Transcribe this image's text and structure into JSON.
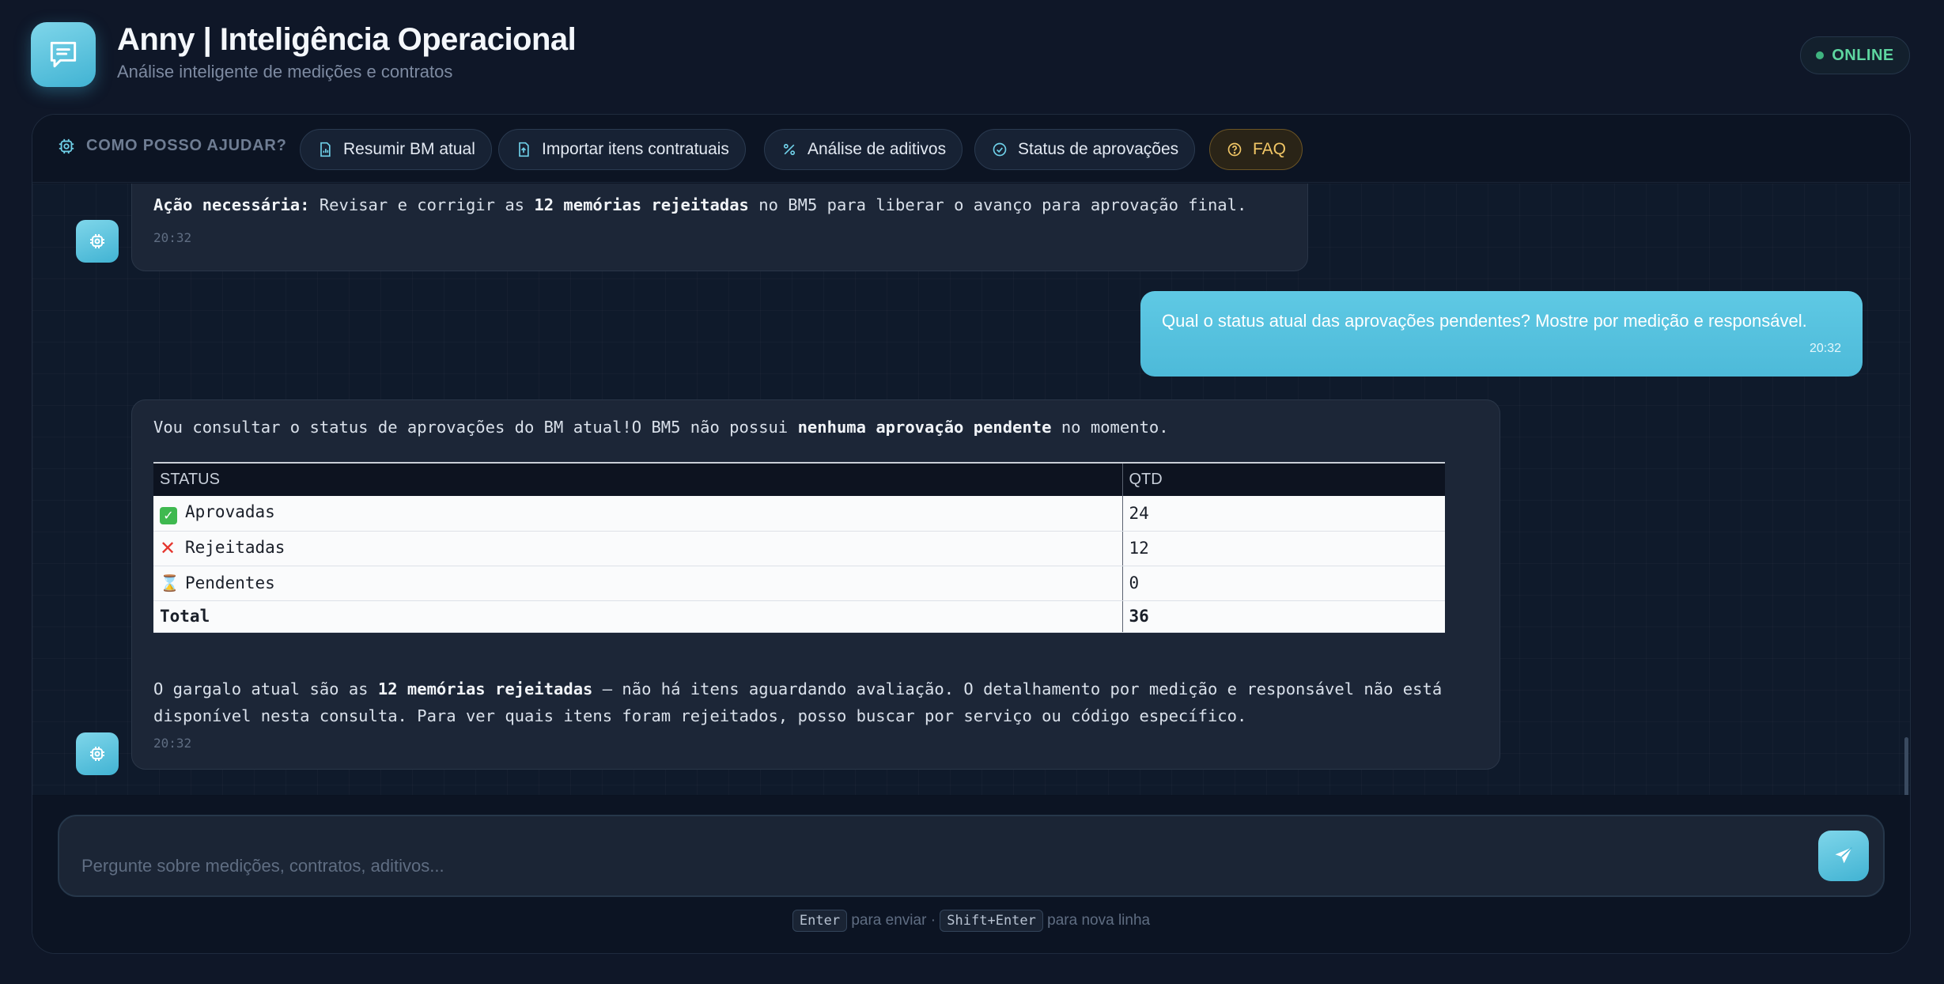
{
  "header": {
    "title": "Anny | Inteligência Operacional",
    "subtitle": "Análise inteligente de medições e contratos",
    "status": "ONLINE",
    "logo_icon": "chat-bubble-icon"
  },
  "toolbar": {
    "help_label": "COMO POSSO AJUDAR?",
    "chips": [
      {
        "label": "Resumir BM atual",
        "icon": "report-icon"
      },
      {
        "label": "Importar itens contratuais",
        "icon": "upload-file-icon"
      },
      {
        "label": "Análise de aditivos",
        "icon": "percent-icon"
      },
      {
        "label": "Status de aprovações",
        "icon": "check-circle-icon"
      },
      {
        "label": "FAQ",
        "icon": "question-circle-icon"
      }
    ]
  },
  "messages": {
    "m1": {
      "bold_prefix": "Ação necessária:",
      "text_a": " Revisar e corrigir as ",
      "bold_mid": "12 memórias rejeitadas",
      "text_b": " no BM5 para liberar o avanço para aprovação final.",
      "time": "20:32"
    },
    "m2": {
      "text": "Qual o status atual das aprovações pendentes? Mostre por medição e responsável.",
      "time": "20:32"
    },
    "m3": {
      "intro_a": "Vou consultar o status de aprovações do BM atual!O BM5 não possui ",
      "intro_bold": "nenhuma aprovação pendente",
      "intro_b": " no momento.",
      "table": {
        "headers": [
          "STATUS",
          "QTD"
        ],
        "rows": [
          {
            "icon": "check-mark-icon",
            "label": "Aprovadas",
            "qtd": "24"
          },
          {
            "icon": "cross-mark-icon",
            "label": "Rejeitadas",
            "qtd": "12"
          },
          {
            "icon": "hourglass-icon",
            "label": "Pendentes",
            "qtd": "0"
          }
        ],
        "total_label": "Total",
        "total_qtd": "36"
      },
      "outro_a": "O gargalo atual são as ",
      "outro_bold": "12 memórias rejeitadas",
      "outro_b": " — não há itens aguardando avaliação. O detalhamento por medição e responsável não está disponível nesta consulta. Para ver quais itens foram rejeitados, posso buscar por serviço ou código específico.",
      "time": "20:32"
    }
  },
  "composer": {
    "placeholder": "Pergunte sobre medições, contratos, aditivos...",
    "hint_key1": "Enter",
    "hint_text1": "para enviar",
    "hint_sep": "·",
    "hint_key2": "Shift+Enter",
    "hint_text2": "para nova linha"
  },
  "colors": {
    "accent": "#4dbad9",
    "online": "#5ed6a0",
    "faq": "#f2c766"
  }
}
